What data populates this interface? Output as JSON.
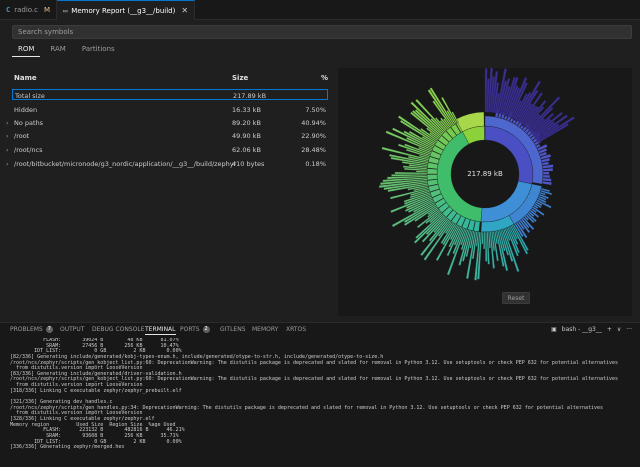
{
  "tabs": [
    {
      "icon": "C",
      "label": "radio.c",
      "modified": "M"
    },
    {
      "icon": "▭",
      "label": "Memory Report (__g3__/build)",
      "close": "✕"
    }
  ],
  "search": {
    "placeholder": "Search symbols"
  },
  "subtabs": [
    "ROM",
    "RAM",
    "Partitions"
  ],
  "table": {
    "headers": {
      "name": "Name",
      "size": "Size",
      "pct": "%"
    },
    "rows": [
      {
        "name": "Total size",
        "size": "217.89 kB",
        "pct": "",
        "chevron": ""
      },
      {
        "name": "Hidden",
        "size": "16.33 kB",
        "pct": "7.50%",
        "chevron": ""
      },
      {
        "name": "No paths",
        "size": "89.20 kB",
        "pct": "40.94%",
        "chevron": "›"
      },
      {
        "name": "/root",
        "size": "49.90 kB",
        "pct": "22.90%",
        "chevron": "›"
      },
      {
        "name": "/root/ncs",
        "size": "62.06 kB",
        "pct": "28.48%",
        "chevron": "›"
      },
      {
        "name": "/root/bitbucket/micronode/g3_nordic/application/__g3__/build/zephyr",
        "size": "410 bytes",
        "pct": "0.18%",
        "chevron": "›"
      }
    ]
  },
  "chart": {
    "center_label": "217.89 kB",
    "reset_label": "Reset",
    "ring_colors": {
      "nopaths": "#3fbd6a",
      "root": "#3e8fd6",
      "ncs": "#4a4fc4",
      "hidden": "#8bd23a",
      "zephyr": "#3a2f8c"
    }
  },
  "panel": {
    "tabs": [
      {
        "label": "PROBLEMS",
        "badge": "7"
      },
      {
        "label": "OUTPUT",
        "badge": ""
      },
      {
        "label": "DEBUG CONSOLE",
        "badge": ""
      },
      {
        "label": "TERMINAL",
        "badge": ""
      },
      {
        "label": "PORTS",
        "badge": "2"
      },
      {
        "label": "GITLENS",
        "badge": ""
      },
      {
        "label": "MEMORY",
        "badge": ""
      },
      {
        "label": "XRTOS",
        "badge": ""
      }
    ],
    "terminal_name": "bash - __g3__",
    "plus": "+",
    "chevron": "∨",
    "more": "···",
    "lines": [
      "           FLASH:       39024 B        48 KB      81.07%",
      "            SRAM:       27456 B       256 KB      10.47%",
      "        IDT_LIST:           0 GB         2 KB       0.00%",
      "[82/336] Generating include/generated/kobj-types-enum.h, include/generated/otype-to-str.h, include/generated/otype-to-size.h",
      "/root/ncs/zephyr/scripts/gen_kobject_list.py:60: DeprecationWarning: The distutils package is deprecated and slated for removal in Python 3.12. Use setuptools or check PEP 632 for potential alternatives",
      "  from distutils.version import LooseVersion",
      "[83/336] Generating include/generated/driver-validation.h",
      "/root/ncs/zephyr/scripts/gen_kobject_list.py:60: DeprecationWarning: The distutils package is deprecated and slated for removal in Python 3.12. Use setuptools or check PEP 632 for potential alternatives",
      "  from distutils.version import LooseVersion",
      "[318/336] Linking C executable zephyr/zephyr_prebuilt.elf",
      "",
      "[321/336] Generating dev_handles.c",
      "/root/ncs/zephyr/scripts/gen_handles.py:34: DeprecationWarning: The distutils package is deprecated and slated for removal in Python 3.12. Use setuptools or check PEP 632 for potential alternatives",
      "  from distutils.version import LooseVersion",
      "[328/336] Linking C executable zephyr/zephyr.elf",
      "Memory region         Used Size  Region Size  %age Used",
      "           FLASH:      223132 B       482816 B      46.21%",
      "            SRAM:       93608 B       256 KB      35.71%",
      "        IDT_LIST:           0 GB         2 KB       0.00%",
      "[336/336] Generating zephyr/merged.hex"
    ]
  }
}
